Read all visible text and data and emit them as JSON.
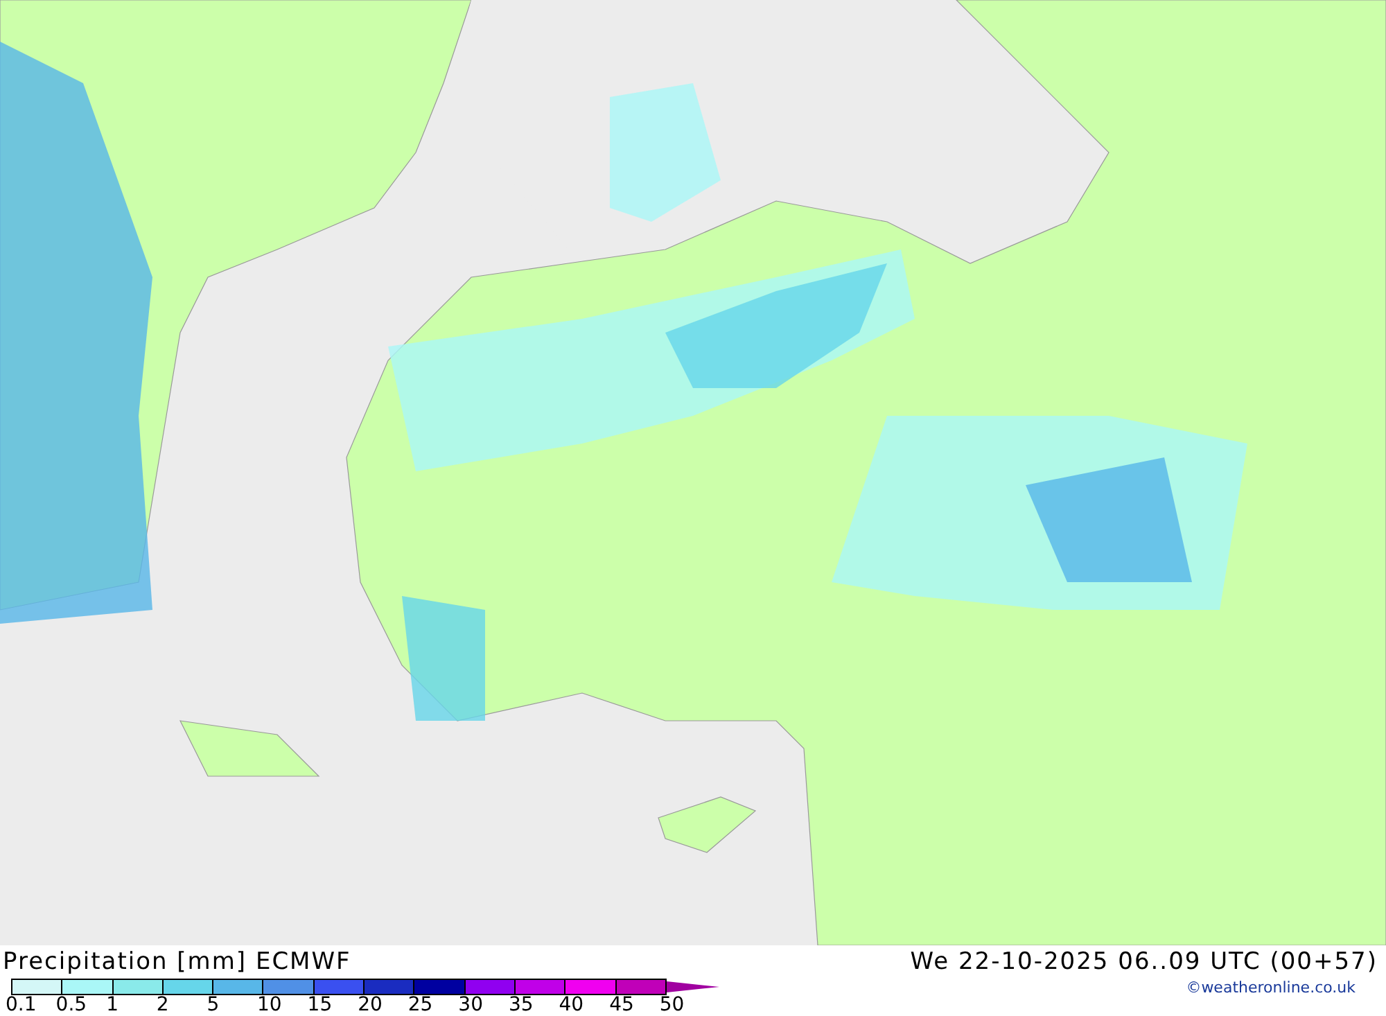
{
  "legend": {
    "title": "Precipitation [mm] ECMWF",
    "bins": [
      {
        "kind": "box",
        "color": "#d4f7f7"
      },
      {
        "kind": "box",
        "color": "#aaf7f7"
      },
      {
        "kind": "box",
        "color": "#8aeaea"
      },
      {
        "kind": "box",
        "color": "#66d6ea"
      },
      {
        "kind": "box",
        "color": "#58b7e8"
      },
      {
        "kind": "box",
        "color": "#5090e6"
      },
      {
        "kind": "box",
        "color": "#3a50f0"
      },
      {
        "kind": "box",
        "color": "#1a2cc0"
      },
      {
        "kind": "box",
        "color": "#0000a0"
      },
      {
        "kind": "box",
        "color": "#9000f0"
      },
      {
        "kind": "box",
        "color": "#c000e8"
      },
      {
        "kind": "box",
        "color": "#f000f0"
      },
      {
        "kind": "box",
        "color": "#c000b8"
      },
      {
        "kind": "arrow",
        "color": "#a000a0"
      }
    ],
    "labels": [
      "0.1",
      "0.5",
      "1",
      "2",
      "5",
      "10",
      "15",
      "20",
      "25",
      "30",
      "35",
      "40",
      "45",
      "50"
    ]
  },
  "valid_time": "We 22-10-2025 06..09 UTC (00+57)",
  "copyright": "©weatheronline.co.uk"
}
